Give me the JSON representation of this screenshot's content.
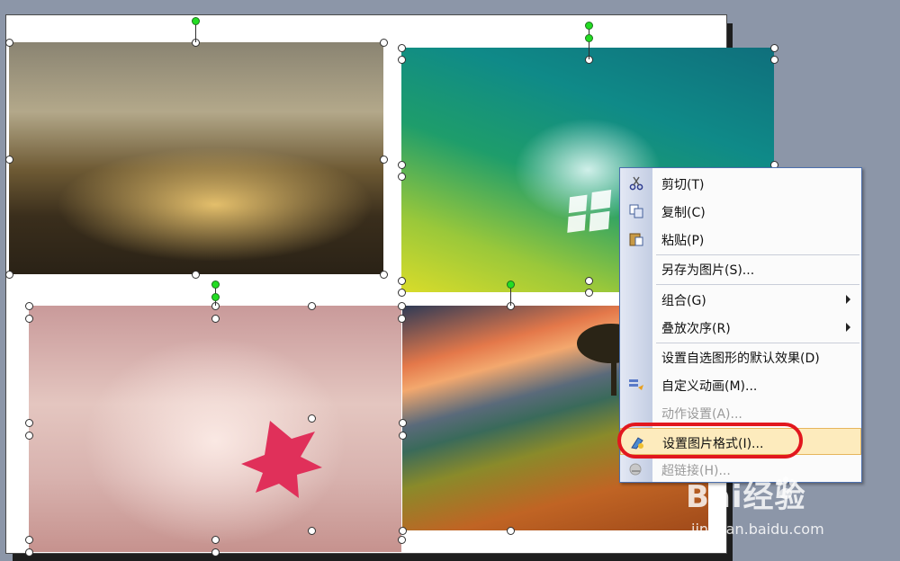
{
  "context_menu": {
    "items": [
      {
        "label": "剪切(T)",
        "icon": "scissors-icon"
      },
      {
        "label": "复制(C)",
        "icon": "copy-icon"
      },
      {
        "label": "粘贴(P)",
        "icon": "paste-icon"
      },
      {
        "label": "另存为图片(S)..."
      },
      {
        "label": "组合(G)",
        "submenu": true
      },
      {
        "label": "叠放次序(R)",
        "submenu": true
      },
      {
        "label": "设置自选图形的默认效果(D)"
      },
      {
        "label": "自定义动画(M)...",
        "icon": "custom-animation-icon"
      },
      {
        "label": "动作设置(A)...",
        "disabled": true
      },
      {
        "label": "设置图片格式(I)...",
        "icon": "format-picture-icon",
        "highlighted": true
      },
      {
        "label": "超链接(H)...",
        "icon": "hyperlink-icon",
        "disabled": true
      }
    ]
  },
  "annotation": {
    "color": "#e2171e",
    "target": "设置图片格式(I)..."
  },
  "watermark": {
    "logo": "Bai经验",
    "url": "jingyan.baidu.com"
  },
  "colors": {
    "background": "#8c96a8",
    "highlight": "#fdebbd",
    "menu_border": "#4c6fad"
  }
}
